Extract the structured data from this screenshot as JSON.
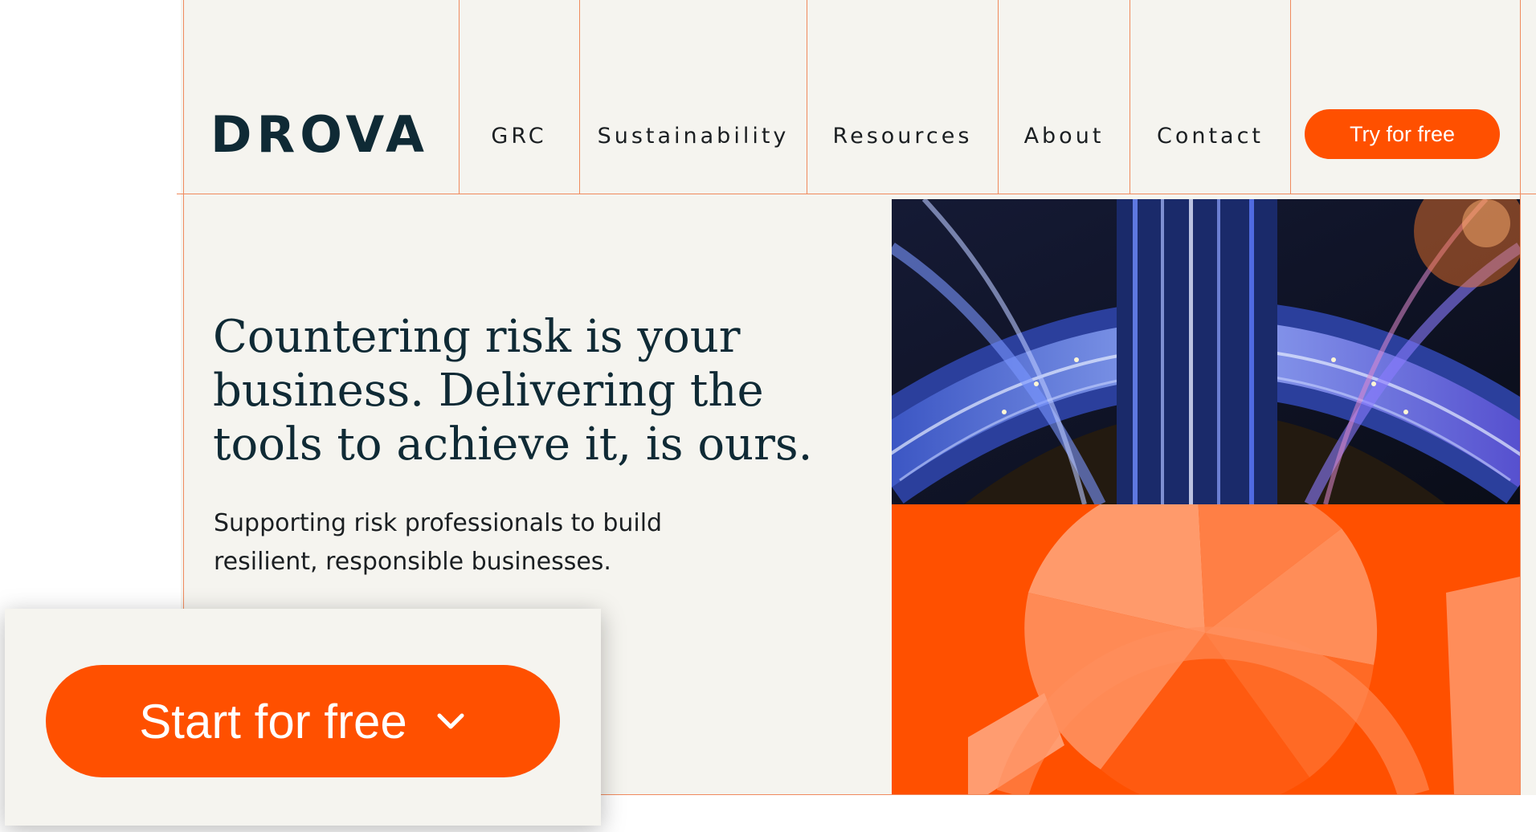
{
  "brand": {
    "logo_text": "DROVA",
    "accent_color": "#ff5000",
    "text_color": "#0f2a35",
    "page_background": "#f5f4ef",
    "grid_line_color": "#f08a5d"
  },
  "nav": {
    "items": [
      {
        "label": "GRC"
      },
      {
        "label": "Sustainability"
      },
      {
        "label": "Resources"
      },
      {
        "label": "About"
      },
      {
        "label": "Contact"
      }
    ],
    "cta_label": "Try for free"
  },
  "hero": {
    "headline": "Countering risk is your business. Delivering the tools to achieve it, is ours.",
    "subtext": "Supporting risk professionals to build resilient, responsible businesses.",
    "photo_icon": "highway-interchange-night-photo",
    "graphic_icon": "orange-abstract-segments"
  },
  "overlay": {
    "cta_label": "Start for free",
    "cta_icon": "chevron-down-icon"
  }
}
